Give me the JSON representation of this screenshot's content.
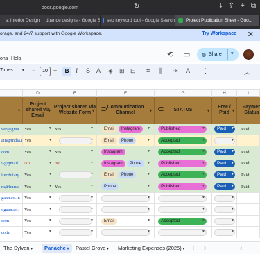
{
  "browser": {
    "url": "docs.google.com",
    "tabs": [
      {
        "label": "s: Interior Design...",
        "color": "#6f6f6f"
      },
      {
        "label": "duande designs - Google Search",
        "color": "#ea4335"
      },
      {
        "label": "seo keyword tool - Google Search",
        "color": "#4285f4"
      },
      {
        "label": "Project Publication Sheet - Goo...",
        "color": "#34a853"
      }
    ]
  },
  "banner": {
    "message": "orage, and 24/7 support with Google Workspace.",
    "cta": "Try Workspace"
  },
  "menu": {
    "items": [
      "ons",
      "Help"
    ],
    "share_label": "Share"
  },
  "toolbar": {
    "font": "Times ...",
    "font_size": "10",
    "bold": "B",
    "italic": "I"
  },
  "columns": [
    "D",
    "E",
    "F",
    "G",
    "H",
    "I"
  ],
  "headers": {
    "shared_email": "Project shared via Email",
    "shared_website": "Project shared via Website Form",
    "channel": "Communication Channel",
    "status": "STATUS",
    "free_paid": "Free / Paid",
    "payment_status": "Paymen Status"
  },
  "rows": [
    {
      "c": "ver@gma",
      "d": "Yes",
      "e": "Yes",
      "chips": [
        "Email",
        "Instagram"
      ],
      "status": "Published",
      "fp": "Paid",
      "pay": "Paid",
      "bg": "#d9ead3"
    },
    {
      "c": "ain@india.in",
      "d": "Yes",
      "e": "",
      "chips": [
        "Email",
        "Phone"
      ],
      "status": "Accepted",
      "fp": "",
      "pay": "",
      "bg": "#fff2cc"
    },
    {
      "c": "com",
      "d": "Yes",
      "e": "Yes",
      "chips": [
        "Instagram"
      ],
      "status": "Accepted",
      "fp": "Paid",
      "pay": "Paid",
      "bg": "#d9ead3"
    },
    {
      "c": "9@gmail",
      "d": "No",
      "e": "No",
      "chips": [
        "Instagram",
        "Phone"
      ],
      "status": "Published",
      "fp": "Paid",
      "pay": "Paid",
      "bg": "#d9ead3"
    },
    {
      "c": "itecduiary",
      "d": "Yes",
      "e": "",
      "chips": [
        "Email",
        "Phone"
      ],
      "status": "Accepted",
      "fp": "Paid",
      "pay": "Paid",
      "bg": "#d9ead3"
    },
    {
      "c": "ra@hurda",
      "d": "Yes",
      "e": "Yes",
      "chips": [
        "Phone"
      ],
      "status": "Published",
      "fp": "Paid",
      "pay": "Paid",
      "bg": "#d9ead3"
    },
    {
      "c": "gaan.co.in",
      "d": "Yes",
      "e": "",
      "chips": [],
      "status": "",
      "fp": "",
      "pay": "",
      "bg": "#ffffff"
    },
    {
      "c": "ogaan.co.",
      "d": "Yes",
      "e": "",
      "chips": [],
      "status": "",
      "fp": "",
      "pay": "",
      "bg": "#ffffff"
    },
    {
      "c": "com",
      "d": "Yes",
      "e": "",
      "chips": [
        "Email"
      ],
      "status": "Accepted",
      "fp": "",
      "pay": "",
      "bg": "#ffffff"
    },
    {
      "c": "co.in",
      "d": "Yes",
      "e": "",
      "chips": [],
      "status": "",
      "fp": "",
      "pay": "",
      "bg": "#ffffff"
    },
    {
      "c": "co.in",
      "d": "Yes",
      "e": "",
      "chips": [],
      "status": "",
      "fp": "",
      "pay": "",
      "bg": "#ffffff"
    }
  ],
  "sheet_tabs": [
    "The Sylven",
    "Panache",
    "Pastel Grove",
    "Marketing Expenses (2025)"
  ],
  "active_sheet": "Panache"
}
